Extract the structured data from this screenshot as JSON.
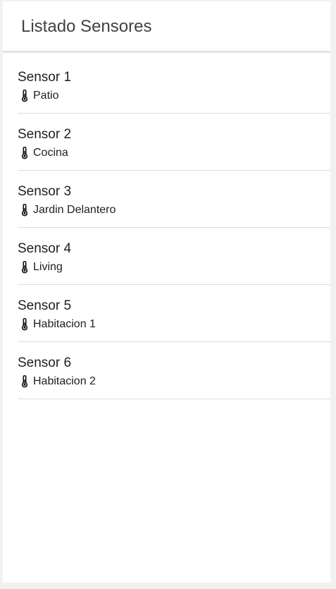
{
  "header": {
    "title": "Listado Sensores"
  },
  "sensors": [
    {
      "name": "Sensor 1",
      "location": "Patio",
      "icon": "thermometer-icon"
    },
    {
      "name": "Sensor 2",
      "location": "Cocina",
      "icon": "thermometer-icon"
    },
    {
      "name": "Sensor 3",
      "location": "Jardin Delantero",
      "icon": "thermometer-icon"
    },
    {
      "name": "Sensor 4",
      "location": "Living",
      "icon": "thermometer-icon"
    },
    {
      "name": "Sensor 5",
      "location": "Habitacion 1",
      "icon": "thermometer-icon"
    },
    {
      "name": "Sensor 6",
      "location": "Habitacion 2",
      "icon": "thermometer-icon"
    }
  ],
  "colors": {
    "background": "#f0f1f1",
    "surface": "#ffffff",
    "title_text": "#424242",
    "item_text": "#202020",
    "divider": "#dcdcdc"
  }
}
